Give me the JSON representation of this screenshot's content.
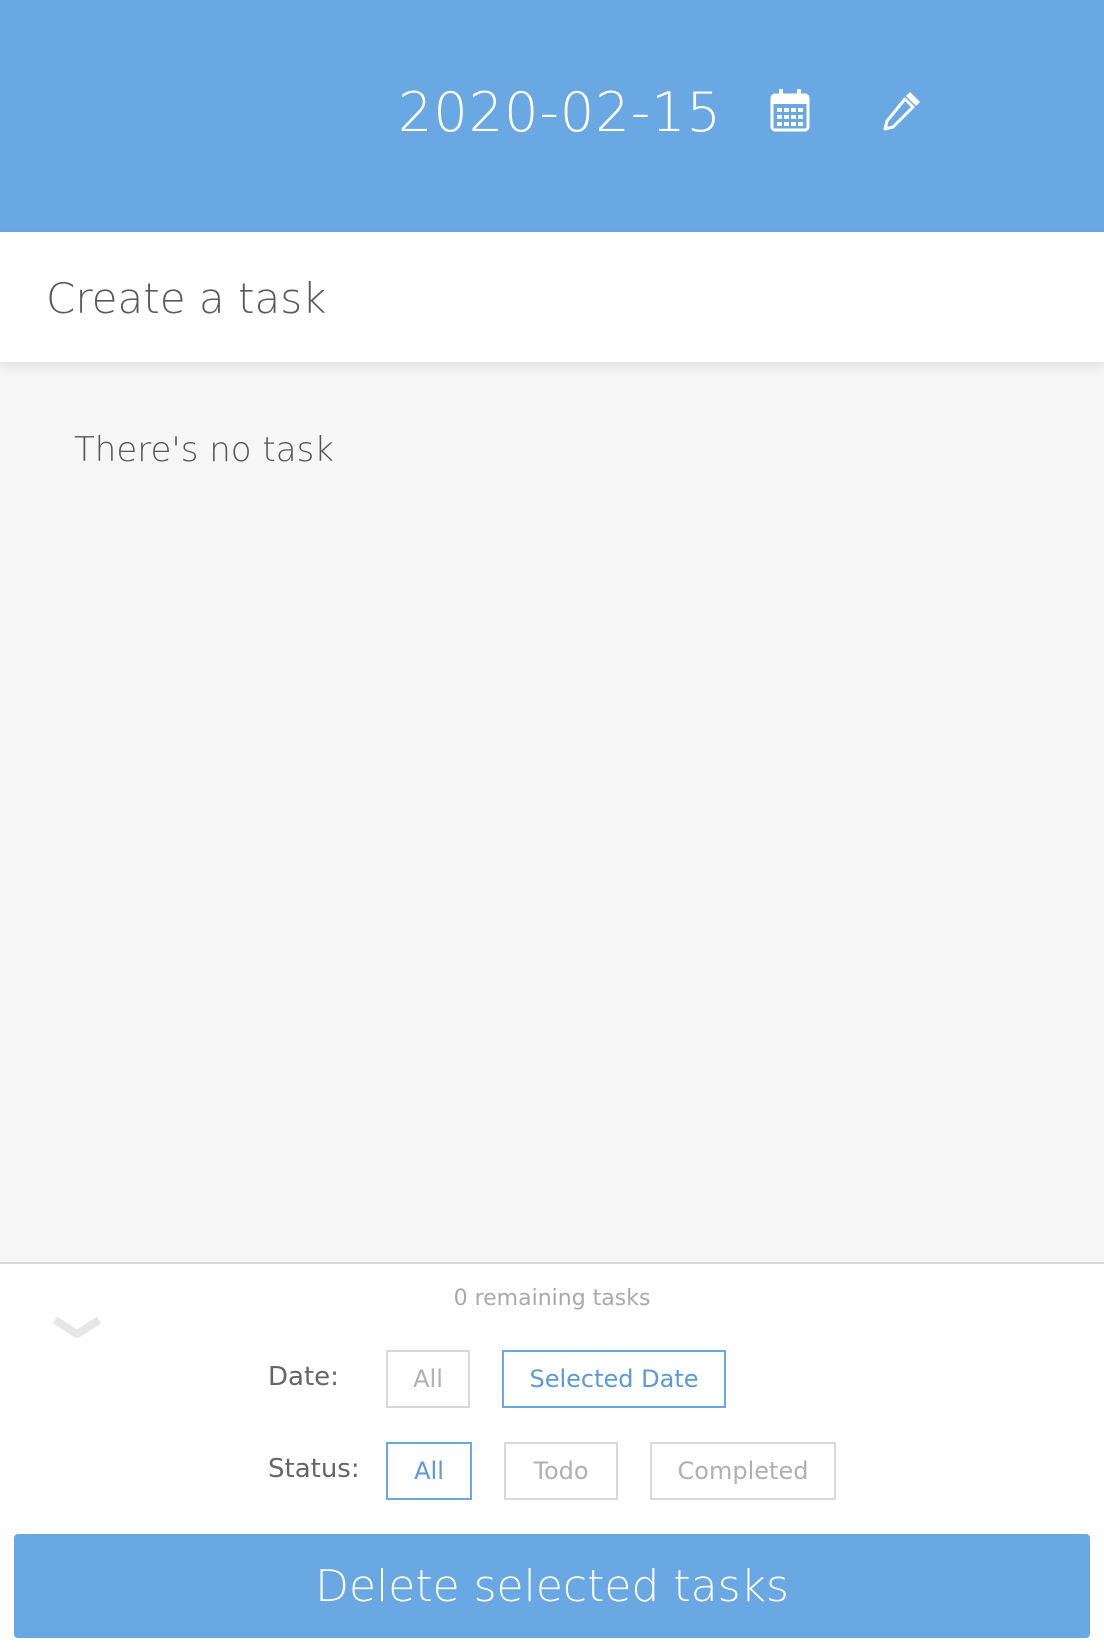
{
  "header": {
    "selected_date": "2020-02-15",
    "icons": [
      "calendar-icon",
      "pencil-icon"
    ],
    "color": "#69a8e2"
  },
  "task_input": {
    "placeholder": "Create a task",
    "value": ""
  },
  "task_list": {
    "empty_message": "There's no task"
  },
  "footer": {
    "remaining_text": "0 remaining tasks",
    "date_filter": {
      "label": "Date:",
      "options": [
        {
          "label": "All",
          "active": false
        },
        {
          "label": "Selected Date",
          "active": true
        }
      ]
    },
    "status_filter": {
      "label": "Status:",
      "options": [
        {
          "label": "All",
          "active": true
        },
        {
          "label": "Todo",
          "active": false
        },
        {
          "label": "Completed",
          "active": false
        }
      ]
    },
    "delete_label": "Delete selected tasks"
  }
}
